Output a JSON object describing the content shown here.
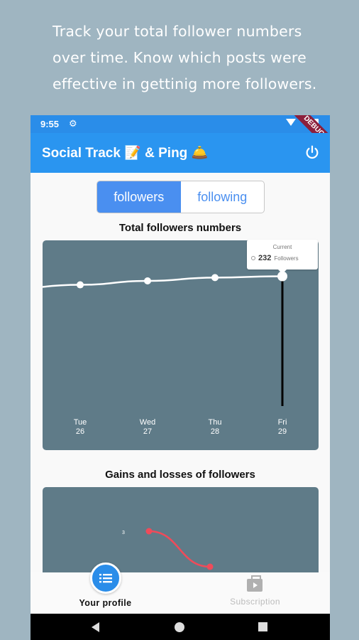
{
  "promo": {
    "line1": "Track your total follower numbers",
    "line2": "over time.  Know which posts were",
    "line3": "effective in gettinig more followers."
  },
  "status_bar": {
    "time": "9:55",
    "debug_banner": "DEBUG"
  },
  "app_bar": {
    "title": "Social Track 📝 & Ping 🛎️"
  },
  "toggle": {
    "options": [
      {
        "label": "followers",
        "selected": true
      },
      {
        "label": "following",
        "selected": false
      }
    ]
  },
  "followers_chart": {
    "title": "Total followers numbers",
    "tooltip_label": "Current",
    "tooltip_value": "232",
    "tooltip_unit": "Followers"
  },
  "gains_chart": {
    "title": "Gains and losses of followers",
    "point_label": "3"
  },
  "chart_data": [
    {
      "type": "line",
      "title": "Total followers numbers",
      "categories": [
        "Tue\n26",
        "Wed\n27",
        "Thu\n28",
        "Fri\n29"
      ],
      "x_labels": [
        {
          "day": "Tue",
          "date": "26"
        },
        {
          "day": "Wed",
          "date": "27"
        },
        {
          "day": "Thu",
          "date": "28"
        },
        {
          "day": "Fri",
          "date": "29"
        }
      ],
      "values": [
        219,
        225,
        230,
        232
      ],
      "ylim": [
        0,
        265
      ],
      "grid": false,
      "colors": {
        "line": "#ffffff",
        "background": "#5f7b88",
        "cursor": "#000000"
      }
    },
    {
      "type": "line",
      "title": "Gains and losses of followers",
      "x": [
        1,
        2
      ],
      "values": [
        3,
        -2
      ],
      "colors": {
        "line": "#ef4b5a",
        "background": "#5f7b88"
      }
    }
  ],
  "bottom_nav": {
    "items": [
      {
        "label": "Your profile",
        "icon": "list-icon",
        "active": true
      },
      {
        "label": "Subscription",
        "icon": "subscription-icon",
        "active": false
      }
    ]
  },
  "colors": {
    "page_background": "#9fb5c1",
    "primary": "#2a95f0",
    "accent": "#4a8ff0"
  }
}
